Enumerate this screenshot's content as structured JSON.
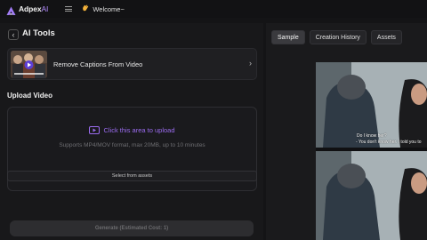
{
  "app": {
    "logo_text": "Adpex",
    "logo_ai": "AI",
    "welcome": "Welcome~"
  },
  "left": {
    "title": "AI Tools",
    "tool_name": "Remove Captions From Video",
    "section_title": "Upload Video",
    "upload_text": "Click this area to upload",
    "upload_hint": "Supports MP4/MOV format, max 20MB, up to 10 minutes",
    "assets_button": "Select from assets",
    "generate_button": "Generate (Estimated Cost: 1)"
  },
  "right": {
    "tabs": [
      {
        "label": "Sample",
        "active": true
      },
      {
        "label": "Creation History",
        "active": false
      },
      {
        "label": "Assets",
        "active": false
      }
    ],
    "captions": {
      "line1": "Do I know her?",
      "line2": "- You don't know her. I told you to"
    }
  },
  "colors": {
    "accent": "#9b6cf0",
    "background": "#141416"
  }
}
